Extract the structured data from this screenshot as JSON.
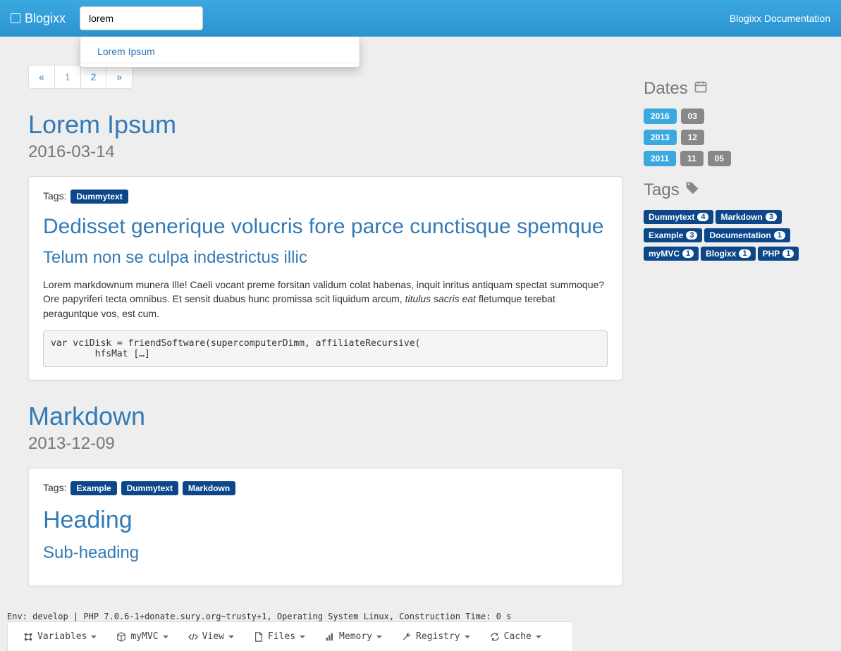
{
  "navbar": {
    "brand": "Blogixx",
    "search_value": "lorem",
    "doc_link": "Blogixx Documentation"
  },
  "autocomplete": {
    "items": [
      "Lorem Ipsum"
    ]
  },
  "pagination": {
    "prev": "«",
    "pages": [
      "1",
      "2"
    ],
    "next": "»",
    "active": 0
  },
  "posts": [
    {
      "title": "Lorem Ipsum",
      "date": "2016-03-14",
      "tags_label": "Tags:",
      "tags": [
        "Dummytext"
      ],
      "h2": "Dedisset generique volucris fore parce cunctisque spemque",
      "h3": "Telum non se culpa indestrictus illic",
      "para_pre": "Lorem markdownum munera Ille! Caeli vocant preme forsitan validum colat habenas, inquit inritus antiquam spectat summoque? Ore papyriferi tecta omnibus. Et sensit duabus hunc promissa scit liquidum arcum, ",
      "para_em": "titulus sacris eat",
      "para_post": " fletumque terebat peraguntque vos, est cum.",
      "code": "var vciDisk = friendSoftware(supercomputerDimm, affiliateRecursive(\n        hfsMat […]"
    },
    {
      "title": "Markdown",
      "date": "2013-12-09",
      "tags_label": "Tags:",
      "tags": [
        "Example",
        "Dummytext",
        "Markdown"
      ],
      "h2": "Heading",
      "h3": "Sub-heading"
    }
  ],
  "sidebar": {
    "dates_title": "Dates",
    "dates": [
      {
        "year": "2016",
        "months": [
          "03"
        ]
      },
      {
        "year": "2013",
        "months": [
          "12"
        ]
      },
      {
        "year": "2011",
        "months": [
          "11",
          "05"
        ]
      }
    ],
    "tags_title": "Tags",
    "tags": [
      {
        "name": "Dummytext",
        "count": "4"
      },
      {
        "name": "Markdown",
        "count": "3"
      },
      {
        "name": "Example",
        "count": "3"
      },
      {
        "name": "Documentation",
        "count": "1"
      },
      {
        "name": "myMVC",
        "count": "1"
      },
      {
        "name": "Blogixx",
        "count": "1"
      },
      {
        "name": "PHP",
        "count": "1"
      }
    ]
  },
  "status": "Env: develop | PHP 7.0.6-1+donate.sury.org~trusty+1, Operating System Linux, Construction Time: 0 s",
  "debugbar": [
    "Variables",
    "myMVC",
    "View",
    "Files",
    "Memory",
    "Registry",
    "Cache"
  ]
}
